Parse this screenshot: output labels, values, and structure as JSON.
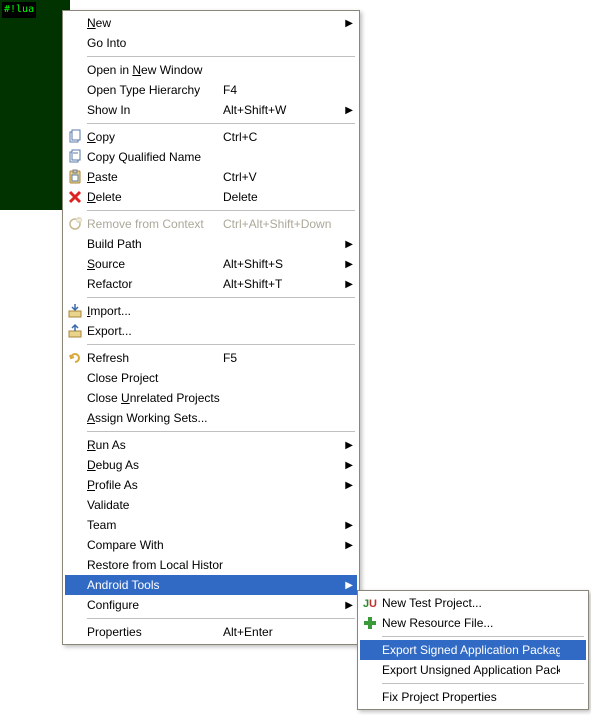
{
  "bg": {
    "lines": [
      "#!lua",
      "",
      "",
      "",
      "",
      "",
      "",
      "",
      "",
      "",
      "",
      "",
      ""
    ]
  },
  "menu": {
    "items": [
      {
        "label": "New",
        "accel": "N",
        "shortcut": "",
        "arrow": true,
        "icon": null
      },
      {
        "label": "Go Into",
        "accel": "",
        "shortcut": "",
        "arrow": false,
        "icon": null
      },
      {
        "sep": true
      },
      {
        "label": "Open in New Window",
        "accel": "N",
        "shortcut": "",
        "arrow": false,
        "icon": null
      },
      {
        "label": "Open Type Hierarchy",
        "accel": "",
        "shortcut": "F4",
        "arrow": false,
        "icon": null
      },
      {
        "label": "Show In",
        "accel": "W",
        "shortcut": "Alt+Shift+W",
        "arrow": true,
        "icon": null
      },
      {
        "sep": true
      },
      {
        "label": "Copy",
        "accel": "C",
        "shortcut": "Ctrl+C",
        "arrow": false,
        "icon": "copy"
      },
      {
        "label": "Copy Qualified Name",
        "accel": "",
        "shortcut": "",
        "arrow": false,
        "icon": "copy-qn"
      },
      {
        "label": "Paste",
        "accel": "P",
        "shortcut": "Ctrl+V",
        "arrow": false,
        "icon": "paste"
      },
      {
        "label": "Delete",
        "accel": "D",
        "shortcut": "Delete",
        "arrow": false,
        "icon": "delete"
      },
      {
        "sep": true
      },
      {
        "label": "Remove from Context",
        "accel": "",
        "shortcut": "Ctrl+Alt+Shift+Down",
        "arrow": false,
        "icon": "remove-ctx",
        "disabled": true
      },
      {
        "label": "Build Path",
        "accel": "",
        "shortcut": "",
        "arrow": true,
        "icon": null
      },
      {
        "label": "Source",
        "accel": "S",
        "shortcut": "Alt+Shift+S",
        "arrow": true,
        "icon": null
      },
      {
        "label": "Refactor",
        "accel": "T",
        "shortcut": "Alt+Shift+T",
        "arrow": true,
        "icon": null
      },
      {
        "sep": true
      },
      {
        "label": "Import...",
        "accel": "I",
        "shortcut": "",
        "arrow": false,
        "icon": "import"
      },
      {
        "label": "Export...",
        "accel": "",
        "shortcut": "",
        "arrow": false,
        "icon": "export"
      },
      {
        "sep": true
      },
      {
        "label": "Refresh",
        "accel": "F",
        "shortcut": "F5",
        "arrow": false,
        "icon": "refresh"
      },
      {
        "label": "Close Project",
        "accel": "",
        "shortcut": "",
        "arrow": false,
        "icon": null
      },
      {
        "label": "Close Unrelated Projects",
        "accel": "U",
        "shortcut": "",
        "arrow": false,
        "icon": null
      },
      {
        "label": "Assign Working Sets...",
        "accel": "A",
        "shortcut": "",
        "arrow": false,
        "icon": null
      },
      {
        "sep": true
      },
      {
        "label": "Run As",
        "accel": "R",
        "shortcut": "",
        "arrow": true,
        "icon": null
      },
      {
        "label": "Debug As",
        "accel": "D",
        "shortcut": "",
        "arrow": true,
        "icon": null
      },
      {
        "label": "Profile As",
        "accel": "P",
        "shortcut": "",
        "arrow": true,
        "icon": null
      },
      {
        "label": "Validate",
        "accel": "",
        "shortcut": "",
        "arrow": false,
        "icon": null
      },
      {
        "label": "Team",
        "accel": "",
        "shortcut": "",
        "arrow": true,
        "icon": null
      },
      {
        "label": "Compare With",
        "accel": "",
        "shortcut": "",
        "arrow": true,
        "icon": null
      },
      {
        "label": "Restore from Local History...",
        "accel": "",
        "shortcut": "",
        "arrow": false,
        "icon": null
      },
      {
        "label": "Android Tools",
        "accel": "",
        "shortcut": "",
        "arrow": true,
        "icon": null,
        "selected": true
      },
      {
        "label": "Configure",
        "accel": "",
        "shortcut": "",
        "arrow": true,
        "icon": null
      },
      {
        "sep": true
      },
      {
        "label": "Properties",
        "accel": "",
        "shortcut": "Alt+Enter",
        "arrow": false,
        "icon": null
      }
    ]
  },
  "submenu": {
    "items": [
      {
        "label": "New Test Project...",
        "accel": "",
        "icon": "ju"
      },
      {
        "label": "New Resource File...",
        "accel": "",
        "icon": "plus"
      },
      {
        "sep": true
      },
      {
        "label": "Export Signed Application Package...",
        "accel": "",
        "icon": null,
        "selected": true
      },
      {
        "label": "Export Unsigned Application Package...",
        "accel": "",
        "icon": null
      },
      {
        "sep": true
      },
      {
        "label": "Fix Project Properties",
        "accel": "",
        "icon": null
      }
    ]
  }
}
